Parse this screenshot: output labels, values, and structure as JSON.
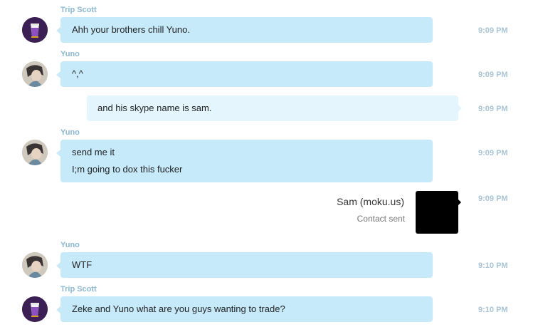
{
  "messages": [
    {
      "sender": "Trip Scott",
      "lines": [
        "Ahh your brothers chill Yuno."
      ],
      "time": "9:09 PM"
    },
    {
      "sender": "Yuno",
      "lines": [
        "^,^"
      ],
      "time": "9:09 PM"
    },
    {
      "sender": "",
      "lines": [
        "and his skype name is sam."
      ],
      "time": "9:09 PM"
    },
    {
      "sender": "Yuno",
      "lines": [
        "send me it",
        "I;m going to dox this fucker"
      ],
      "time": "9:09 PM"
    },
    {
      "sender": "",
      "contact": {
        "name": "Sam (moku.us)",
        "status": "Contact sent"
      },
      "time": "9:09 PM"
    },
    {
      "sender": "Yuno",
      "lines": [
        "WTF"
      ],
      "time": "9:10 PM"
    },
    {
      "sender": "Trip Scott",
      "lines": [
        "Zeke and Yuno what are you guys wanting to trade?"
      ],
      "time": "9:10 PM"
    }
  ],
  "colors": {
    "bubble_incoming": "#c7eafb",
    "bubble_outgoing": "#e4f5fd",
    "sender_name": "#8ab9d6",
    "timestamp": "#a8c4d6"
  },
  "icons": {
    "trip_scott_avatar": "purple-cup-icon",
    "yuno_avatar": "person-photo-icon",
    "contact_card": "contact-card-icon"
  }
}
